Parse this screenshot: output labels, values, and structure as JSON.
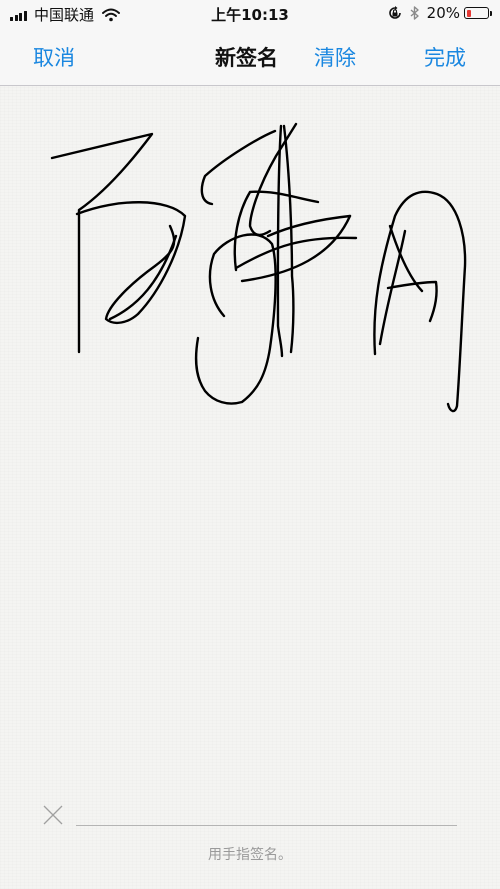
{
  "status_bar": {
    "carrier": "中国联通",
    "time": "上午10:13",
    "battery_percent": "20%",
    "battery_level": 0.2,
    "battery_color": "#e53935",
    "icons": [
      "signal-icon",
      "wifi-icon",
      "orientation-lock-icon",
      "bluetooth-icon",
      "battery-icon"
    ]
  },
  "nav": {
    "cancel_label": "取消",
    "title": "新签名",
    "clear_label": "清除",
    "done_label": "完成",
    "accent_color": "#1a87e0"
  },
  "signature_pad": {
    "hint": "用手指签名。",
    "clear_icon": "close-icon"
  }
}
